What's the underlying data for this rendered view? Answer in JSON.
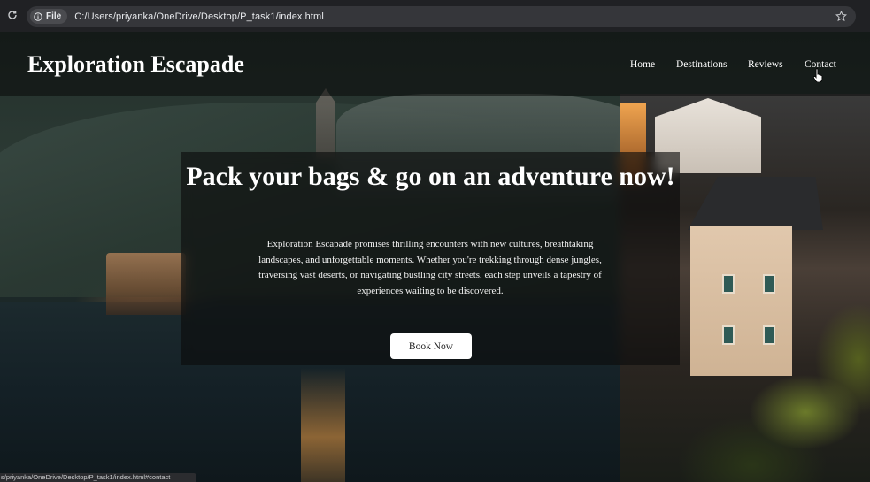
{
  "browser": {
    "scheme_label": "File",
    "url": "C:/Users/priyanka/OneDrive/Desktop/P_task1/index.html",
    "status_url": "s/priyanka/OneDrive/Desktop/P_task1/index.html#contact"
  },
  "nav": {
    "brand": "Exploration Escapade",
    "links": [
      "Home",
      "Destinations",
      "Reviews",
      "Contact"
    ]
  },
  "hero": {
    "title": "Pack your bags & go on an adventure now!",
    "text": "Exploration Escapade promises thrilling encounters with new cultures, breathtaking landscapes, and unforgettable moments. Whether you're trekking through dense jungles, traversing vast deserts, or navigating bustling city streets, each step unveils a tapestry of experiences waiting to be discovered.",
    "cta_label": "Book Now"
  },
  "icons": {
    "reload": "reload-icon",
    "info": "info-icon",
    "bookmark": "star-icon",
    "cursor": "cursor-icon"
  }
}
